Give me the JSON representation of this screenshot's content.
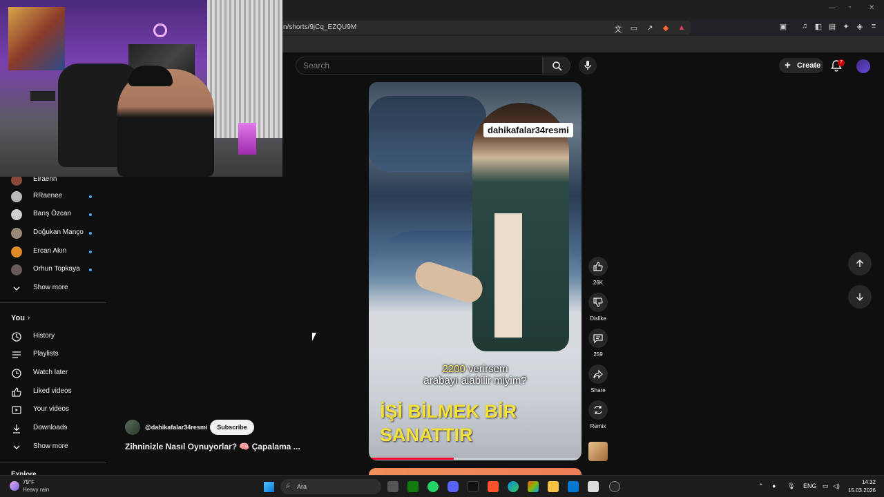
{
  "browser": {
    "url": "n/shorts/9jCq_EZQU9M"
  },
  "header": {
    "search_placeholder": "Search",
    "create_label": "Create",
    "notification_count": "7"
  },
  "sidebar": {
    "subscriptions": [
      {
        "label": "Elraenn",
        "dot": false,
        "color": "#8a4a3a"
      },
      {
        "label": "RRaenee",
        "dot": true,
        "color": "#bbbbbb"
      },
      {
        "label": "Barış Özcan",
        "dot": true,
        "color": "#d0d0d0"
      },
      {
        "label": "Doğukan Manço",
        "dot": true,
        "color": "#9a8a7a"
      },
      {
        "label": "Ercan Akın",
        "dot": true,
        "color": "#e08a2a"
      },
      {
        "label": "Orhun Topkaya",
        "dot": true,
        "color": "#6a5a5a"
      }
    ],
    "show_more_1": "Show more",
    "you_title": "You",
    "you_items": [
      {
        "label": "History",
        "icon": "history-icon"
      },
      {
        "label": "Playlists",
        "icon": "playlists-icon"
      },
      {
        "label": "Watch later",
        "icon": "watch-later-icon"
      },
      {
        "label": "Liked videos",
        "icon": "like-icon"
      },
      {
        "label": "Your videos",
        "icon": "your-videos-icon"
      },
      {
        "label": "Downloads",
        "icon": "download-icon"
      }
    ],
    "show_more_2": "Show more",
    "explore_title": "Explore"
  },
  "short": {
    "watermark": "dahikafalar34resmi",
    "subtitle_number": "2200",
    "subtitle_line1_rest": " verirsem",
    "subtitle_line2": "arabayı alabilir miyim?",
    "overlay_text_line1": "İŞİ BİLMEK BİR",
    "overlay_text_line2": "SANATTIR",
    "progress": 0.4
  },
  "actions": {
    "like_count": "26K",
    "dislike_label": "Dislike",
    "comment_count": "259",
    "share_label": "Share",
    "remix_label": "Remix"
  },
  "channel": {
    "handle": "@dahikafalar34resmi",
    "subscribe_label": "Subscribe",
    "video_title": "Zihninizle Nasıl Oynuyorlar? 🧠 Çapalama ..."
  },
  "taskbar": {
    "temperature": "79°F",
    "weather": "Heavy rain",
    "search_label": "Ara",
    "language": "ENG",
    "time": "14:32",
    "date": "15.03.2026"
  }
}
